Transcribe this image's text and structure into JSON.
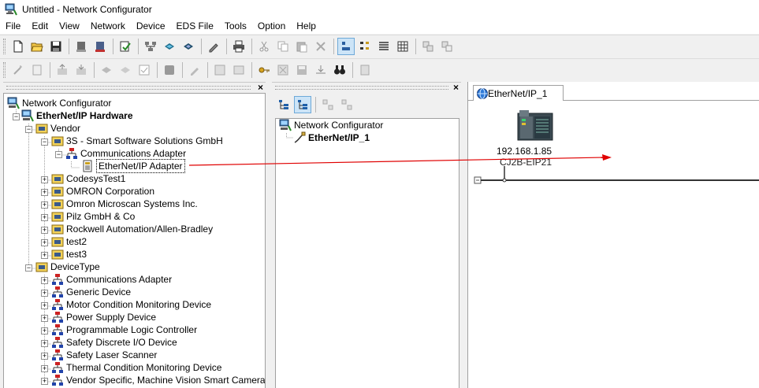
{
  "window": {
    "title": "Untitled - Network Configurator"
  },
  "menu": [
    "File",
    "Edit",
    "View",
    "Network",
    "Device",
    "EDS File",
    "Tools",
    "Option",
    "Help"
  ],
  "left_tree": {
    "root": "Network Configurator",
    "hardware": "EtherNet/IP Hardware",
    "vendor": "Vendor",
    "vendor_3s": "3S - Smart Software Solutions GmbH",
    "comm_adapter": "Communications Adapter",
    "eip_adapter": "EtherNet/IP Adapter",
    "vendors": [
      "CodesysTest1",
      "OMRON Corporation",
      "Omron Microscan Systems Inc.",
      "Pilz GmbH & Co",
      "Rockwell Automation/Allen-Bradley",
      "test2",
      "test3"
    ],
    "device_type": "DeviceType",
    "device_types": [
      "Communications Adapter",
      "Generic Device",
      "Motor Condition Monitoring Device",
      "Power Supply Device",
      "Programmable Logic Controller",
      "Safety Discrete I/O Device",
      "Safety Laser Scanner",
      "Thermal Condition Monitoring Device",
      "Vendor Specific, Machine Vision Smart Camera"
    ]
  },
  "mid_tree": {
    "root": "Network Configurator",
    "network": "EtherNet/IP_1"
  },
  "network_view": {
    "tab": "EtherNet/IP_1",
    "device_ip": "192.168.1.85",
    "device_model": "CJ2B-EIP21"
  },
  "colors": {
    "arrow": "#e00000",
    "selection_blue": "#cce4f7"
  }
}
